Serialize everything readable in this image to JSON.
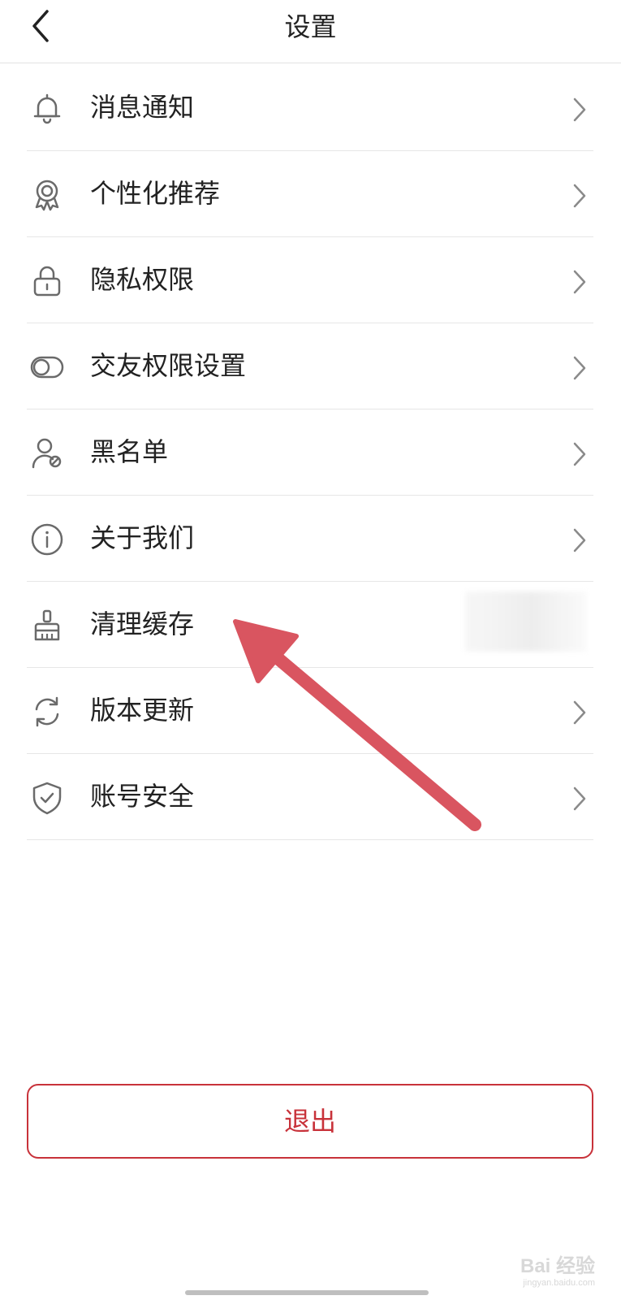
{
  "header": {
    "title": "设置",
    "back_icon": "chevron-left-icon"
  },
  "settings": {
    "items": [
      {
        "label": "消息通知",
        "icon": "bell-icon"
      },
      {
        "label": "个性化推荐",
        "icon": "badge-icon"
      },
      {
        "label": "隐私权限",
        "icon": "lock-icon"
      },
      {
        "label": "交友权限设置",
        "icon": "toggle-icon"
      },
      {
        "label": "黑名单",
        "icon": "user-blocked-icon"
      },
      {
        "label": "关于我们",
        "icon": "info-icon"
      },
      {
        "label": "清理缓存",
        "icon": "broom-icon"
      },
      {
        "label": "版本更新",
        "icon": "refresh-icon"
      },
      {
        "label": "账号安全",
        "icon": "shield-check-icon"
      }
    ]
  },
  "logout": {
    "label": "退出"
  },
  "colors": {
    "accent": "#c8323a",
    "annotation_arrow": "#d95560",
    "icon_gray": "#6a6a6a",
    "divider": "#e6e6e6"
  },
  "watermark": {
    "main": "Bai 经验",
    "sub": "jingyan.baidu.com"
  }
}
